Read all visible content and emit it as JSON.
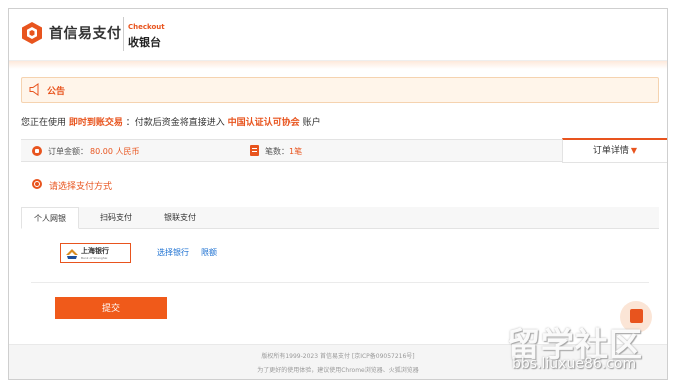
{
  "header": {
    "brand": "首信易支付",
    "checkout_en": "Checkout",
    "checkout_zh": "收银台"
  },
  "notice": {
    "title": "公告"
  },
  "info": {
    "prefix": "您正在使用",
    "trade_type": "即时到账交易",
    "middle": "：付款后资金将直接进入",
    "payee": "中国认证认可协会",
    "suffix": "账户"
  },
  "order": {
    "amount_label": "订单金额：",
    "amount_value": "80.00 人民币",
    "count_label": "笔数：",
    "count_value": "1笔",
    "detail_label": "订单详情",
    "detail_arrow": "▼"
  },
  "payment": {
    "choose_label": "请选择支付方式",
    "tabs": [
      {
        "label": "个人网银",
        "active": true
      },
      {
        "label": "扫码支付",
        "active": false
      },
      {
        "label": "银联支付",
        "active": false
      }
    ],
    "bank": {
      "name": "上海银行",
      "name_en": "Bank of Shanghai"
    },
    "choose_bank": "选择银行",
    "limit": "限额",
    "submit": "提交"
  },
  "footer": {
    "copyright": "版权所有1999-2023 首信易支付 [京ICP备09057216号]",
    "browser_tip": "为了更好的使用体验，建议使用Chrome浏览器、火狐浏览器"
  },
  "watermark": {
    "text": "留学社区",
    "url": "bbs.liuxue86.com"
  },
  "colors": {
    "accent": "#e8541e",
    "link": "#1a6fd1",
    "submit_bg": "#f05a1a"
  },
  "icons": [
    "brand-logo-icon",
    "speaker-icon",
    "order-amount-icon",
    "document-icon",
    "radio-selected-icon",
    "bank-emblem-icon",
    "floating-action-icon"
  ]
}
